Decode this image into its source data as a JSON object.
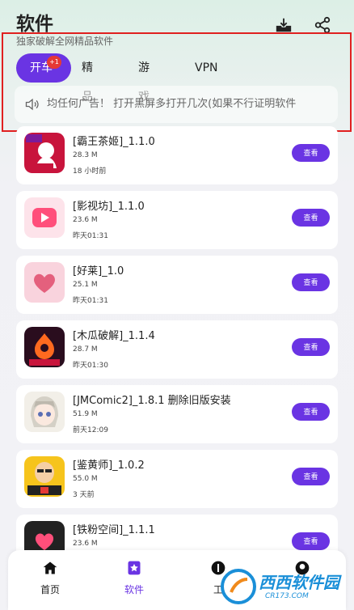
{
  "header": {
    "title": "软件",
    "subtitle": "独家破解全网精品软件",
    "download_icon": "download-tray-icon",
    "share_icon": "share-icon"
  },
  "tabs": [
    {
      "label": "开车",
      "active": true,
      "badge": "+1"
    },
    {
      "label": "精品",
      "active": false
    },
    {
      "label": "游戏",
      "active": false
    },
    {
      "label": "VPN",
      "active": false
    }
  ],
  "notice": {
    "icon": "speaker-icon",
    "text": "均任何广告！    打开黑屏多打开几次(如果不行证明软件"
  },
  "apps": [
    {
      "name": "[霸王茶姬]_1.1.0",
      "size": "28.3 M",
      "time": "18 小时前",
      "button": "查看",
      "icon_colors": [
        "#c8143c",
        "#ffffff"
      ]
    },
    {
      "name": "[影视坊]_1.1.0",
      "size": "23.6 M",
      "time": "昨天01:31",
      "button": "查看",
      "icon_colors": [
        "#fde3ea",
        "#ff4f7b"
      ]
    },
    {
      "name": "[好莱]_1.0",
      "size": "25.1 M",
      "time": "昨天01:31",
      "button": "查看",
      "icon_colors": [
        "#f9d3dd",
        "#e4607d"
      ]
    },
    {
      "name": "[木瓜破解]_1.1.4",
      "size": "28.7 M",
      "time": "昨天01:30",
      "button": "查看",
      "icon_colors": [
        "#2a0d1e",
        "#ff6a1f"
      ]
    },
    {
      "name": "[JMComic2]_1.8.1 删除旧版安装",
      "size": "51.9 M",
      "time": "前天12:09",
      "button": "查看",
      "icon_colors": [
        "#f2efe8",
        "#d4d0c6"
      ]
    },
    {
      "name": "[鉴黄师]_1.0.2",
      "size": "55.0 M",
      "time": "3 天前",
      "button": "查看",
      "icon_colors": [
        "#f6c41c",
        "#222222"
      ]
    },
    {
      "name": "[铁粉空间]_1.1.1",
      "size": "23.6 M",
      "time": "",
      "button": "查看",
      "icon_colors": [
        "#222222",
        "#ff4f7b"
      ]
    }
  ],
  "nav": [
    {
      "label": "首页",
      "icon": "home-icon",
      "active": false
    },
    {
      "label": "软件",
      "icon": "star-bookmark-icon",
      "active": true
    },
    {
      "label": "工",
      "icon": "tools-icon",
      "active": false
    },
    {
      "label": "",
      "icon": "profile-icon",
      "active": false
    }
  ],
  "watermark": {
    "text": "西西软件园",
    "url": "CR173.COM"
  },
  "colors": {
    "accent": "#6a34e3",
    "badge": "#e53935",
    "annotation_box": "#e02020"
  }
}
